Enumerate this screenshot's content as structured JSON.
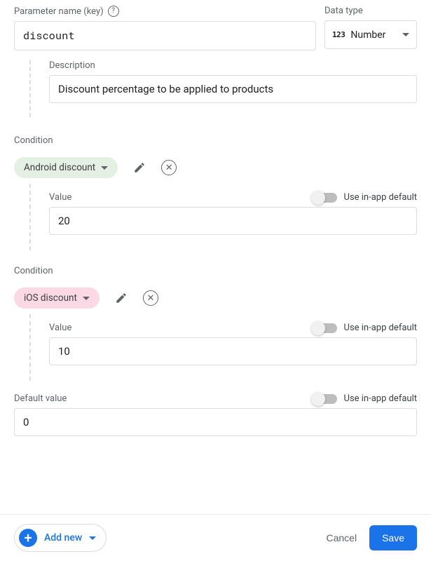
{
  "labels": {
    "param_name": "Parameter name (key)",
    "data_type": "Data type",
    "description": "Description",
    "condition": "Condition",
    "value": "Value",
    "default_value": "Default value",
    "use_in_app_default": "Use in-app default",
    "add_new": "Add new",
    "cancel": "Cancel",
    "save": "Save"
  },
  "param": {
    "name": "discount",
    "data_type": "Number",
    "description": "Discount percentage to be applied to products",
    "default_value": "0"
  },
  "conditions": [
    {
      "name": "Android discount",
      "chip_class": "chip-green",
      "value": "20"
    },
    {
      "name": "iOS discount",
      "chip_class": "chip-pink",
      "value": "10"
    }
  ]
}
